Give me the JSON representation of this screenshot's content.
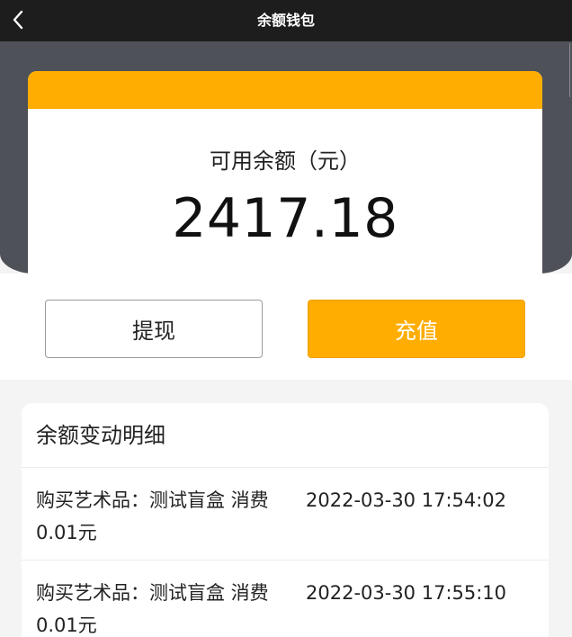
{
  "header": {
    "title": "余额钱包",
    "back_icon": "chevron-left-icon"
  },
  "balance": {
    "label": "可用余额（元）",
    "amount": "2417.18"
  },
  "actions": {
    "withdraw_label": "提现",
    "recharge_label": "充值"
  },
  "details": {
    "heading": "余额变动明细",
    "items": [
      {
        "description": "购买艺术品：测试盲盒 消费0.01元",
        "time": "2022-03-30 17:54:02"
      },
      {
        "description": "购买艺术品：测试盲盒 消费0.01元",
        "time": "2022-03-30 17:55:10"
      }
    ]
  },
  "colors": {
    "accent": "#ffad00",
    "header_bg": "#1d1d1d",
    "hero_bg": "#4f5158"
  }
}
